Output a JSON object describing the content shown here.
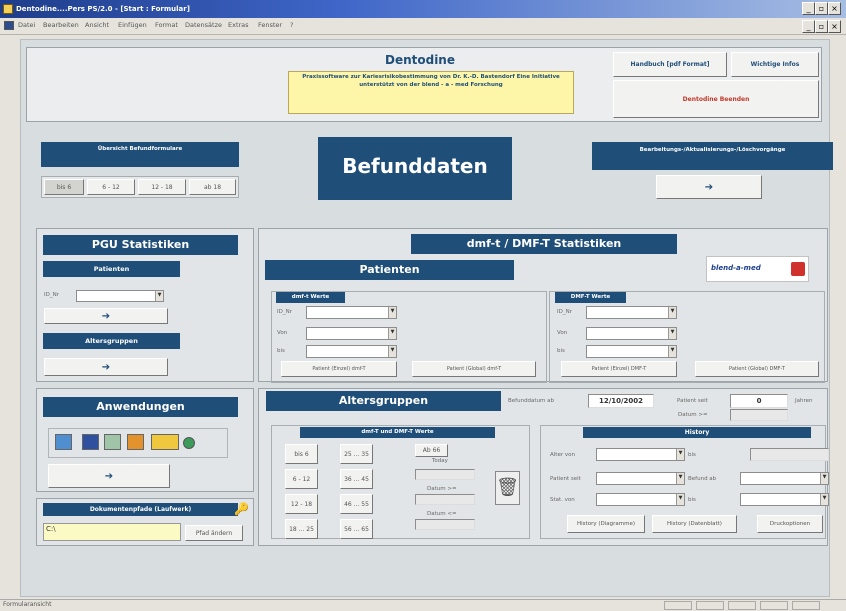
{
  "window": {
    "title": "Dentodine....Pers PS/2.0 - [Start : Formular]"
  },
  "menu": [
    "Datei",
    "Bearbeiten",
    "Ansicht",
    "Einfügen",
    "Format",
    "Datensätze",
    "Extras",
    "Fenster",
    "?"
  ],
  "header": {
    "app_name": "Dentodine",
    "description": "Praxissoftware zur Kariesrisikobestimmung von Dr. K.-D. Bastendorf Eine Initiative unterstützt von der blend - a - med Forschung",
    "handbook_button": "Handbuch [pdf Format]",
    "info_button": "Wichtige Infos",
    "exit_button": "Dentodine Beenden"
  },
  "overview": {
    "title": "Übersicht Befundformulare",
    "buttons": [
      "bis 6",
      "6 - 12",
      "12 - 18",
      "ab 18"
    ]
  },
  "befunddaten": {
    "label": "Befunddaten"
  },
  "edit": {
    "title": "Bearbeitungs-/Aktualisierungs-/Löschvorgänge",
    "arrow": "➔"
  },
  "pgu": {
    "title": "PGU Statistiken",
    "patients_label": "Patienten",
    "id_label": "ID_Nr",
    "age_groups_label": "Altersgruppen",
    "arrow": "➔"
  },
  "dmf": {
    "title": "dmf-t / DMF-T Statistiken",
    "patients_label": "Patienten",
    "logo_text": "blend-a-med",
    "dmf_small": {
      "title": "dmf-t Werte",
      "labels": [
        "ID_Nr",
        "Von",
        "bis"
      ],
      "btn_single": "Patient (Einzel) dmf-T",
      "btn_global": "Patient (Global) dmf-T"
    },
    "dmf_big": {
      "title": "DMF-T Werte",
      "labels": [
        "ID_Nr",
        "Von",
        "bis"
      ],
      "btn_single": "Patient (Einzel) DMF-T",
      "btn_global": "Patient (Global) DMF-T"
    }
  },
  "anwendungen": {
    "title": "Anwendungen",
    "arrow": "➔"
  },
  "docpath": {
    "title": "Dokumentenpfade (Laufwerk)",
    "value": "C:\\",
    "button": "Pfad ändern"
  },
  "altersgruppen": {
    "title": "Altersgruppen",
    "befund_label": "Befunddatum ab",
    "befund_value": "12/10/2002",
    "patient_seit_label": "Patient seit",
    "patient_seit_value": "0",
    "jahren_label": "Jahren",
    "datum_label": "Datum >=",
    "panel_title": "dmf-T und DMF-T Werte",
    "age_buttons": [
      [
        "bis 6",
        "25 ... 35",
        "Ab 66"
      ],
      [
        "6 - 12",
        "36 ... 45"
      ],
      [
        "12 - 18",
        "46 ... 55"
      ],
      [
        "18 ... 25",
        "56 ... 65"
      ]
    ],
    "today_label": "Today",
    "datum_ge_label": "Datum >=",
    "datum_le_label": "Datum <="
  },
  "history": {
    "title": "History",
    "rows": [
      {
        "label": "Alter von",
        "mid": "bis"
      },
      {
        "label": "Patient seit",
        "mid": "Befund ab"
      },
      {
        "label": "Stat. von",
        "mid": "bis"
      }
    ],
    "btn_diagram": "History (Diagramme)",
    "btn_datenblatt": "History (Datenblatt)",
    "btn_druck": "Druckoptionen"
  },
  "status": {
    "text": "Formularansicht"
  }
}
